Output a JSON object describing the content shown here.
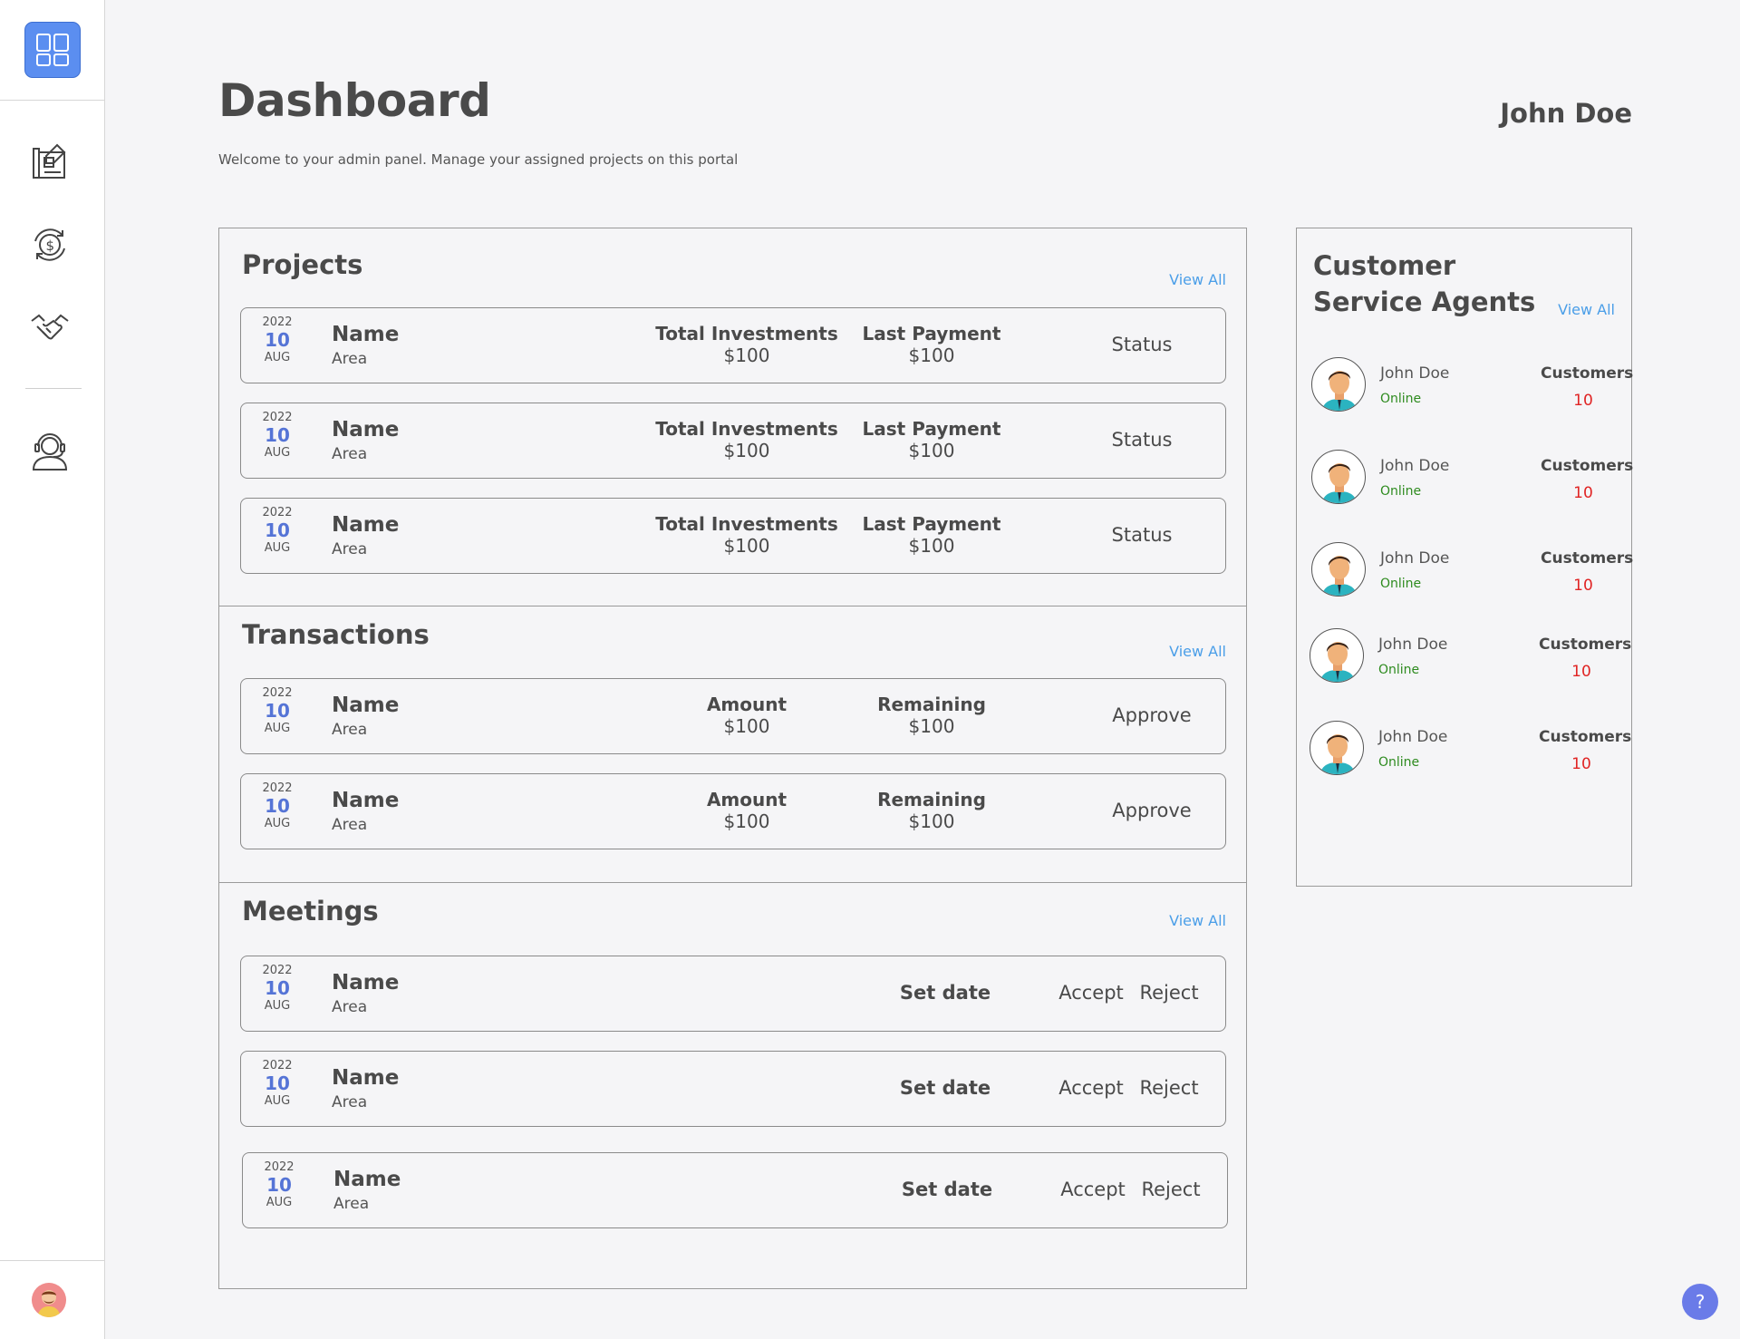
{
  "header": {
    "title": "Dashboard",
    "subtitle": "Welcome to your admin panel. Manage your assigned projects on this portal",
    "user_name": "John Doe"
  },
  "sidebar": {
    "items": [
      {
        "icon": "dashboard-icon"
      },
      {
        "icon": "projects-blueprint-icon"
      },
      {
        "icon": "money-cycle-icon"
      },
      {
        "icon": "handshake-icon"
      },
      {
        "icon": "customer-support-icon"
      }
    ],
    "bottom_icon": "user-avatar-icon"
  },
  "projects": {
    "title": "Projects",
    "view_all": "View All",
    "rows": [
      {
        "year": "2022",
        "day": "10",
        "month": "AUG",
        "name": "Name",
        "area": "Area",
        "col1_h": "Total Investments",
        "col1_v": "$100",
        "col2_h": "Last Payment",
        "col2_v": "$100",
        "status": "Status"
      },
      {
        "year": "2022",
        "day": "10",
        "month": "AUG",
        "name": "Name",
        "area": "Area",
        "col1_h": "Total Investments",
        "col1_v": "$100",
        "col2_h": "Last Payment",
        "col2_v": "$100",
        "status": "Status"
      },
      {
        "year": "2022",
        "day": "10",
        "month": "AUG",
        "name": "Name",
        "area": "Area",
        "col1_h": "Total Investments",
        "col1_v": "$100",
        "col2_h": "Last Payment",
        "col2_v": "$100",
        "status": "Status"
      }
    ]
  },
  "transactions": {
    "title": "Transactions",
    "view_all": "View All",
    "rows": [
      {
        "year": "2022",
        "day": "10",
        "month": "AUG",
        "name": "Name",
        "area": "Area",
        "col1_h": "Amount",
        "col1_v": "$100",
        "col2_h": "Remaining",
        "col2_v": "$100",
        "action": "Approve"
      },
      {
        "year": "2022",
        "day": "10",
        "month": "AUG",
        "name": "Name",
        "area": "Area",
        "col1_h": "Amount",
        "col1_v": "$100",
        "col2_h": "Remaining",
        "col2_v": "$100",
        "action": "Approve"
      }
    ]
  },
  "meetings": {
    "title": "Meetings",
    "view_all": "View All",
    "rows": [
      {
        "year": "2022",
        "day": "10",
        "month": "AUG",
        "name": "Name",
        "area": "Area",
        "set_date": "Set date",
        "accept": "Accept",
        "reject": "Reject"
      },
      {
        "year": "2022",
        "day": "10",
        "month": "AUG",
        "name": "Name",
        "area": "Area",
        "set_date": "Set date",
        "accept": "Accept",
        "reject": "Reject"
      },
      {
        "year": "2022",
        "day": "10",
        "month": "AUG",
        "name": "Name",
        "area": "Area",
        "set_date": "Set date",
        "accept": "Accept",
        "reject": "Reject"
      }
    ]
  },
  "agents": {
    "title": "Customer Service Agents",
    "view_all": "View All",
    "list": [
      {
        "name": "John Doe",
        "status": "Online",
        "customers_label": "Customers",
        "customers": "10"
      },
      {
        "name": "John Doe",
        "status": "Online",
        "customers_label": "Customers",
        "customers": "10"
      },
      {
        "name": "John Doe",
        "status": "Online",
        "customers_label": "Customers",
        "customers": "10"
      },
      {
        "name": "John Doe",
        "status": "Online",
        "customers_label": "Customers",
        "customers": "10"
      },
      {
        "name": "John Doe",
        "status": "Online",
        "customers_label": "Customers",
        "customers": "10"
      }
    ]
  },
  "help": {
    "label": "?"
  },
  "colors": {
    "accent": "#5b8ef0",
    "date_day": "#5574d6",
    "link": "#4a9ee8",
    "online": "#2e8b1f",
    "count": "#e02424"
  }
}
